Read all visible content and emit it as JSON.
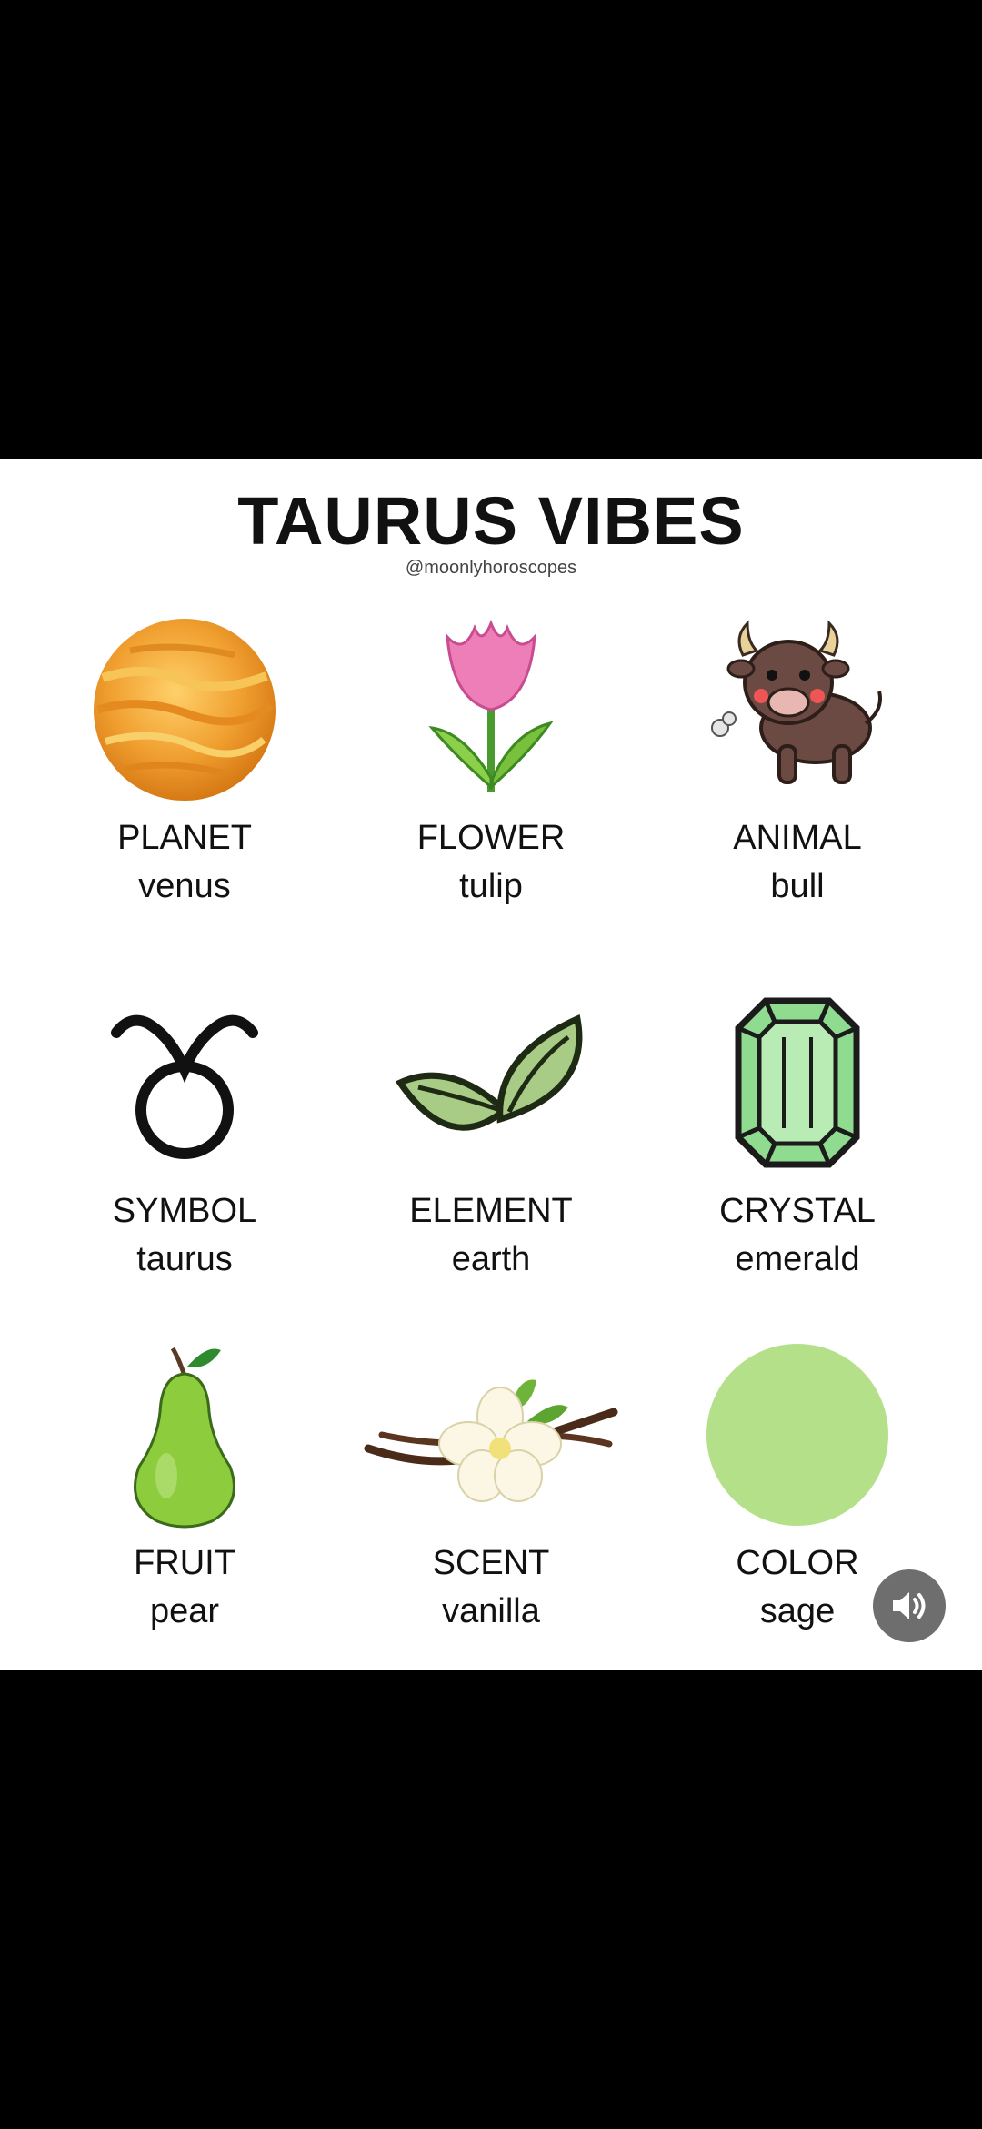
{
  "title": "TAURUS VIBES",
  "handle": "@moonlyhoroscopes",
  "items": [
    {
      "label": "PLANET",
      "value": "venus",
      "icon": "venus-planet-icon"
    },
    {
      "label": "FLOWER",
      "value": "tulip",
      "icon": "tulip-icon"
    },
    {
      "label": "ANIMAL",
      "value": "bull",
      "icon": "bull-icon"
    },
    {
      "label": "SYMBOL",
      "value": "taurus",
      "icon": "taurus-symbol-icon"
    },
    {
      "label": "ELEMENT",
      "value": "earth",
      "icon": "leaves-icon"
    },
    {
      "label": "CRYSTAL",
      "value": "emerald",
      "icon": "emerald-icon"
    },
    {
      "label": "FRUIT",
      "value": "pear",
      "icon": "pear-icon"
    },
    {
      "label": "SCENT",
      "value": "vanilla",
      "icon": "vanilla-icon"
    },
    {
      "label": "COLOR",
      "value": "sage",
      "icon": "sage-swatch-icon"
    }
  ],
  "colors": {
    "sage": "#b5e08a",
    "background": "#000000",
    "card": "#ffffff"
  },
  "sound_button_icon": "speaker-icon"
}
